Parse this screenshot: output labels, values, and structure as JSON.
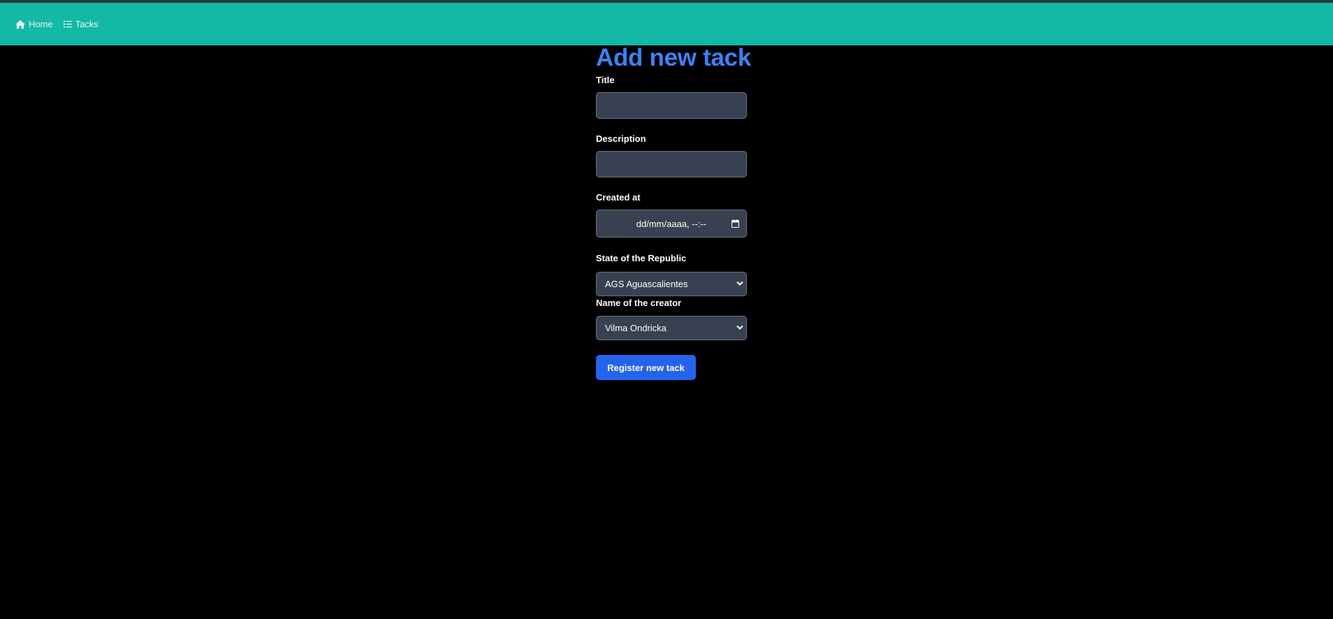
{
  "nav": {
    "items": [
      {
        "label": "Home",
        "icon": "home-icon"
      },
      {
        "label": "Tacks",
        "icon": "list-icon"
      }
    ]
  },
  "form": {
    "title": "Add new tack",
    "fields": {
      "title": {
        "label": "Title",
        "value": ""
      },
      "description": {
        "label": "Description",
        "value": ""
      },
      "created_at": {
        "label": "Created at",
        "placeholder": "dd/mm/aaaa, --:--"
      },
      "state": {
        "label": "State of the Republic",
        "selected": "AGS Aguascalientes"
      },
      "creator": {
        "label": "Name of the creator",
        "selected": "Vilma Ondricka"
      }
    },
    "submit_label": "Register new tack"
  },
  "colors": {
    "navbar": "#14b8a6",
    "title": "#3b82f6",
    "button": "#2563eb",
    "input_bg": "#374151",
    "background": "#000000"
  }
}
